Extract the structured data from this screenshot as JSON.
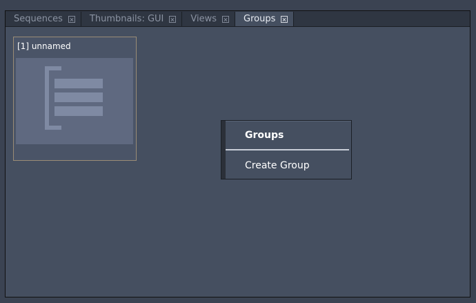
{
  "tabs": [
    {
      "label": "Sequences",
      "active": false
    },
    {
      "label": "Thumbnails: GUI",
      "active": false
    },
    {
      "label": "Views",
      "active": false
    },
    {
      "label": "Groups",
      "active": true
    }
  ],
  "group_card": {
    "label": "[1] unnamed",
    "icon": "group-list-icon"
  },
  "context_menu": {
    "title": "Groups",
    "items": [
      "Create Group"
    ]
  },
  "colors": {
    "panel_bg": "#454f60",
    "tabbar_bg": "#2f3642",
    "card_border": "#9b8d76",
    "thumb_bg": "#5f6980",
    "icon_fill": "#7f8aa3"
  }
}
